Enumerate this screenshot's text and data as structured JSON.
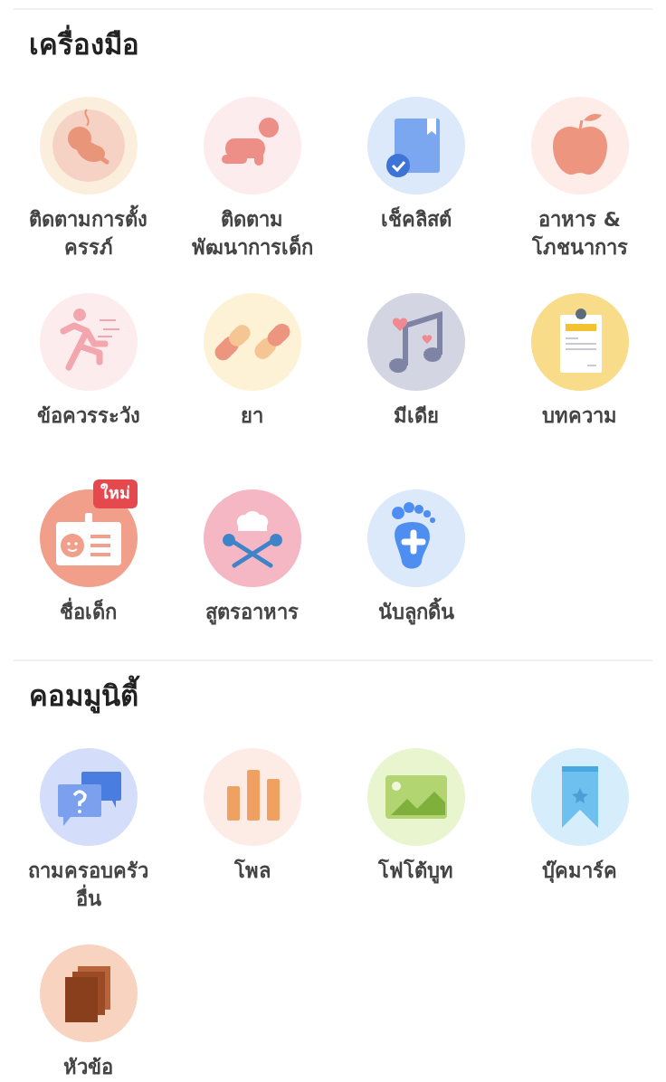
{
  "sections": [
    {
      "title": "เครื่องมือ",
      "items": [
        {
          "kind": "fetus",
          "label": "ติดตามการตั้ง\nครรภ์"
        },
        {
          "kind": "baby",
          "label": "ติดตาม\nพัฒนาการเด็ก"
        },
        {
          "kind": "checklist",
          "label": "เช็คลิสต์"
        },
        {
          "kind": "apple",
          "label": "อาหาร &\nโภชนาการ"
        },
        {
          "kind": "runner",
          "label": "ข้อควรระวัง"
        },
        {
          "kind": "pills",
          "label": "ยา"
        },
        {
          "kind": "music",
          "label": "มีเดีย"
        },
        {
          "kind": "clipboard",
          "label": "บทความ"
        },
        {
          "kind": "idcard",
          "label": "ชื่อเด็ก",
          "badge": "ใหม่"
        },
        {
          "kind": "chef",
          "label": "สูตรอาหาร"
        },
        {
          "kind": "foot",
          "label": "นับลูกดิ้น"
        }
      ]
    },
    {
      "title": "คอมมูนิตี้",
      "items": [
        {
          "kind": "chat",
          "label": "ถามครอบครัว\nอื่น"
        },
        {
          "kind": "poll",
          "label": "โพล"
        },
        {
          "kind": "photo",
          "label": "โฟโต้บูท"
        },
        {
          "kind": "bookmark",
          "label": "บุ๊คมาร์ค"
        },
        {
          "kind": "pages",
          "label": "หัวข้อ"
        }
      ]
    }
  ]
}
